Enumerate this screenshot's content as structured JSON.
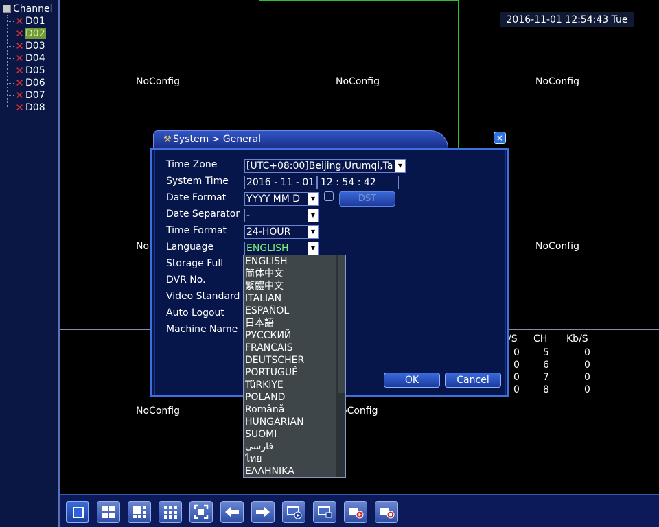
{
  "sidebar": {
    "title": "Channel",
    "channels": [
      {
        "label": "D01"
      },
      {
        "label": "D02"
      },
      {
        "label": "D03"
      },
      {
        "label": "D04"
      },
      {
        "label": "D05"
      },
      {
        "label": "D06"
      },
      {
        "label": "D07"
      },
      {
        "label": "D08"
      }
    ]
  },
  "grid": {
    "datetime": "2016-11-01 12:54:43 Tue",
    "cells": [
      {
        "label": "NoConfig"
      },
      {
        "label": "NoConfig"
      },
      {
        "label": "NoConfig"
      },
      {
        "label": "No"
      },
      {
        "label": "NoConfig"
      },
      {
        "label": "NoConfig"
      },
      {
        "label": "oConfig"
      }
    ],
    "stats": {
      "headers": [
        "/S",
        "CH",
        "Kb/S"
      ],
      "rows": [
        [
          "0",
          "5",
          "0"
        ],
        [
          "0",
          "6",
          "0"
        ],
        [
          "0",
          "7",
          "0"
        ],
        [
          "0",
          "8",
          "0"
        ]
      ]
    }
  },
  "dialog": {
    "title": "System > General",
    "close_label": "×",
    "labels": {
      "time_zone": "Time Zone",
      "system_time": "System Time",
      "date_format": "Date Format",
      "date_separator": "Date Separator",
      "time_format": "Time Format",
      "language": "Language",
      "storage_full": "Storage Full",
      "dvr_no": "DVR No.",
      "video_standard": "Video Standard",
      "auto_logout": "Auto Logout",
      "machine_name": "Machine Name"
    },
    "values": {
      "time_zone": "[UTC+08:00]Beijing,Urumqi,Ta",
      "system_date": "2016 - 11 - 01",
      "system_clock": "12 : 54 : 42",
      "date_format": "YYYY MM D",
      "date_separator": "-",
      "time_format": "24-HOUR",
      "language": "ENGLISH"
    },
    "dst_label": "DST",
    "ok_label": "OK",
    "cancel_label": "Cancel"
  },
  "language_options": [
    "ENGLISH",
    "简体中文",
    "繁體中文",
    "ITALIAN",
    "ESPAÑOL",
    "日本語",
    "РУССКИЙ",
    "FRANCAIS",
    "DEUTSCHER",
    "PORTUGUÊ",
    "TüRKiYE",
    "POLAND",
    "Românǎ",
    "HUNGARIAN",
    "SUOMI",
    "فارسی",
    "ไทย",
    "ΕΛΛΗΝΙΚΑ"
  ],
  "toolbar": {
    "buttons": [
      {
        "icon": "single-view-icon"
      },
      {
        "icon": "quad-view-icon"
      },
      {
        "icon": "six-view-icon"
      },
      {
        "icon": "nine-view-icon"
      },
      {
        "icon": "fullscreen-icon"
      },
      {
        "icon": "arrow-left-icon"
      },
      {
        "icon": "arrow-right-icon"
      },
      {
        "icon": "playback-icon"
      },
      {
        "icon": "monitor-icon"
      },
      {
        "icon": "record-icon"
      },
      {
        "icon": "stop-record-icon"
      }
    ]
  },
  "colors": {
    "selected_channel": "#6f9a39",
    "error_x": "#e53131",
    "language_value": "#7cf07c",
    "grid_line": "#8a86b8",
    "active_cell_border": "#2cc12c"
  }
}
